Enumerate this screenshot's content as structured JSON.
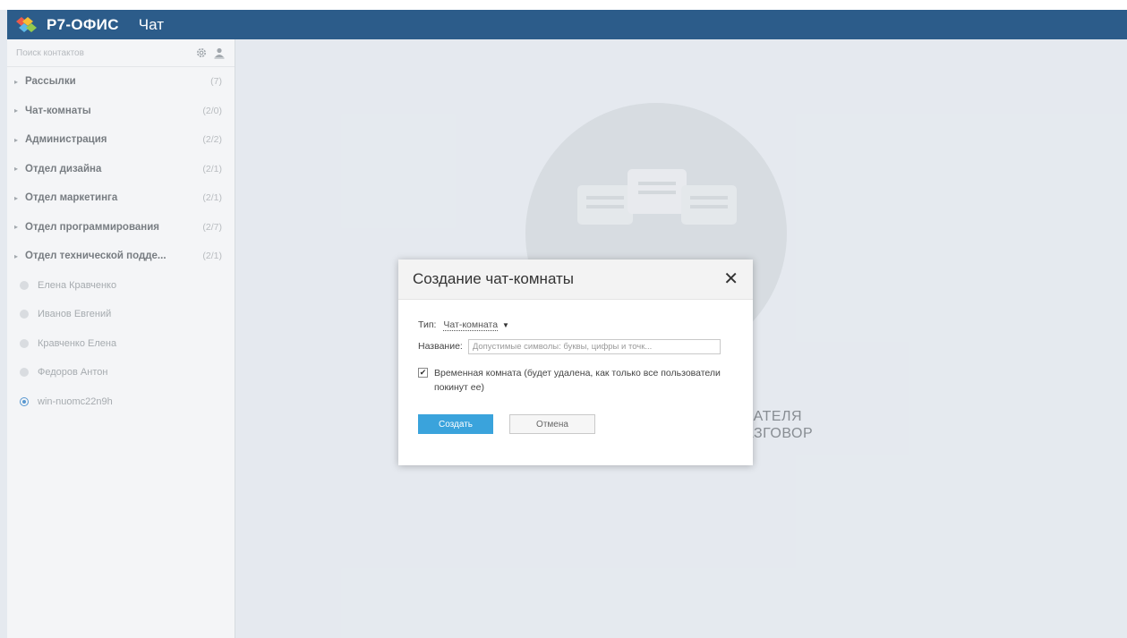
{
  "header": {
    "logo_text": "Р7-ОФИС",
    "app_title": "Чат"
  },
  "sidebar": {
    "search_placeholder": "Поиск контактов",
    "groups": [
      {
        "label": "Рассылки",
        "count": "(7)"
      },
      {
        "label": "Чат-комнаты",
        "count": "(2/0)"
      },
      {
        "label": "Администрация",
        "count": "(2/2)"
      },
      {
        "label": "Отдел дизайна",
        "count": "(2/1)"
      },
      {
        "label": "Отдел маркетинга",
        "count": "(2/1)"
      },
      {
        "label": "Отдел программирования",
        "count": "(2/7)"
      },
      {
        "label": "Отдел технической подде...",
        "count": "(2/1)"
      }
    ],
    "contacts": [
      {
        "name": "Елена Кравченко",
        "status": "offline"
      },
      {
        "name": "Иванов Евгений",
        "status": "offline"
      },
      {
        "name": "Кравченко Елена",
        "status": "offline"
      },
      {
        "name": "Федоров Антон",
        "status": "offline"
      },
      {
        "name": "win-nuomc22n9h",
        "status": "online"
      }
    ]
  },
  "main": {
    "hint_line1": "ВАТЕЛЯ",
    "hint_line2": "АЗГОВОР"
  },
  "dialog": {
    "title": "Создание чат-комнаты",
    "type_label": "Тип:",
    "type_value": "Чат-комната",
    "name_label": "Название:",
    "name_placeholder": "Допустимые символы: буквы, цифры и точк...",
    "temporary_label": "Временная комната (будет удалена, как только все пользователи покинут ее)",
    "temporary_checked": true,
    "create_button": "Создать",
    "cancel_button": "Отмена"
  },
  "colors": {
    "topbar": "#1b4f80",
    "primary_button": "#3aa3dc",
    "background": "#e3e8ee"
  }
}
